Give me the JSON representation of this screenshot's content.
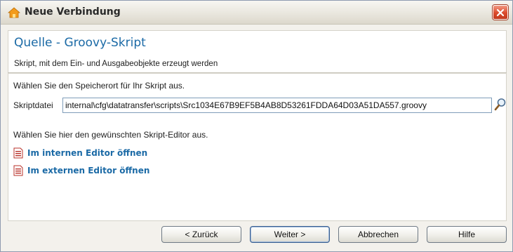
{
  "window": {
    "title": "Neue Verbindung"
  },
  "header": {
    "title": "Quelle - Groovy-Skript",
    "subtitle": "Skript, mit dem Ein- und Ausgabeobjekte erzeugt werden"
  },
  "content": {
    "location_prompt": "Wählen Sie den Speicherort für Ihr Skript aus.",
    "script_file_label": "Skriptdatei",
    "script_file_value": "internal\\cfg\\datatransfer\\scripts\\Src1034E67B9EF5B4AB8D53261FDDA64D03A51DA557.groovy",
    "editor_prompt": "Wählen Sie hier den gewünschten Skript-Editor aus.",
    "links": [
      {
        "label": "Im internen Editor öffnen",
        "icon": "groovy-file-icon"
      },
      {
        "label": "Im externen Editor öffnen",
        "icon": "groovy-file-icon"
      }
    ]
  },
  "buttons": {
    "back": "< Zurück",
    "next": "Weiter >",
    "cancel": "Abbrechen",
    "help": "Hilfe"
  },
  "colors": {
    "accent": "#1b6aa6",
    "close": "#db4a2c"
  }
}
